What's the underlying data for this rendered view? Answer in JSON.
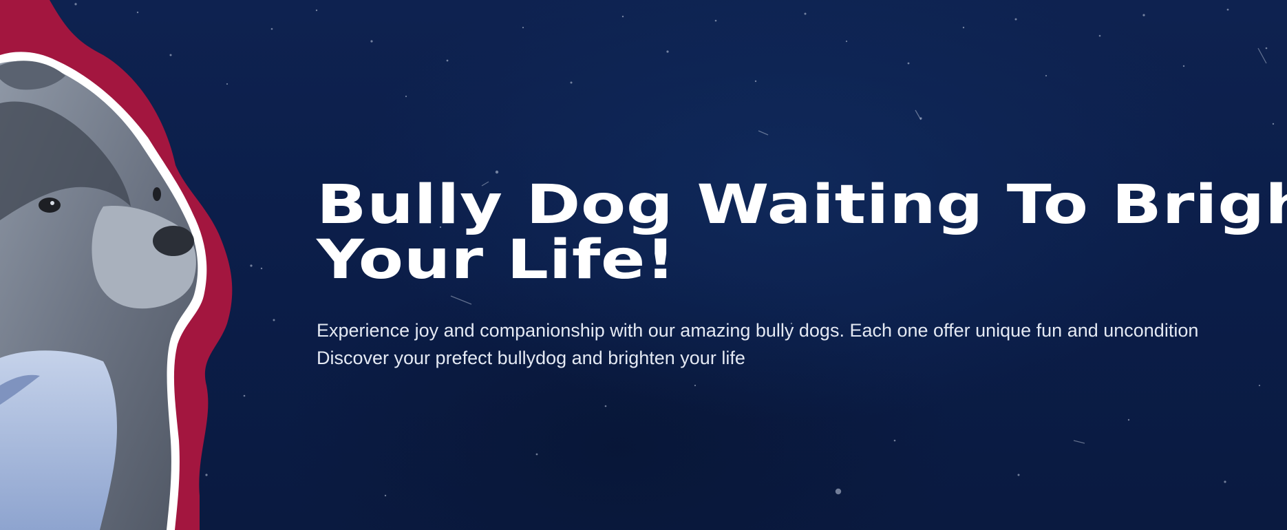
{
  "hero": {
    "title_line1": "Bully Dog Waiting To Brighten",
    "title_line2": "Your Life!",
    "description_line1": "Experience joy and companionship with our amazing bully dogs. Each one offer unique fun and uncondition",
    "description_line2": "Discover your prefect bullydog and brighten your life"
  },
  "images": {
    "dog": "bully-dog-photo"
  },
  "colors": {
    "background": "#0c1e47",
    "accent_red": "#a3163f",
    "outline_white": "#ffffff",
    "title_text": "#ffffff",
    "body_text": "#e4e9f3"
  }
}
